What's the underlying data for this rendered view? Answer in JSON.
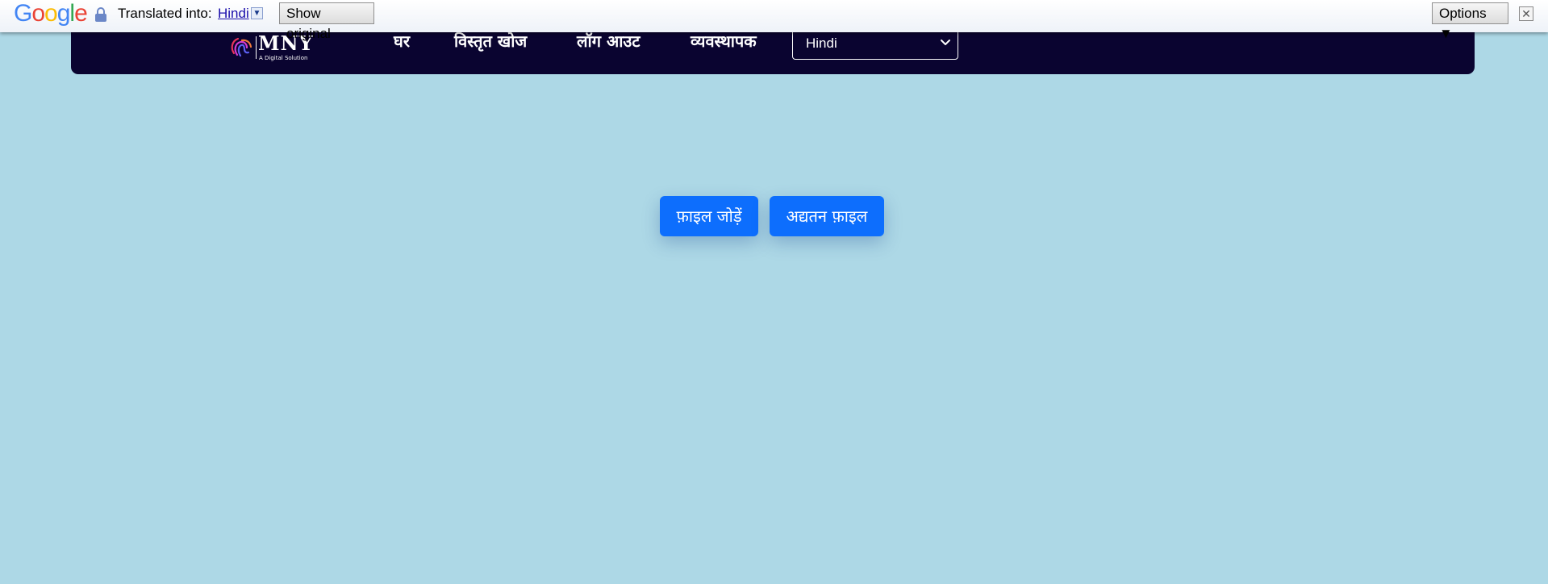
{
  "translate_bar": {
    "logo_letters": [
      "G",
      "o",
      "o",
      "g",
      "l",
      "e"
    ],
    "label": "Translated into:",
    "language": "Hindi",
    "language_arrow": "▼",
    "show_original": "Show original",
    "options": "Options ▼",
    "close": "✕",
    "icons": [
      "lock-icon",
      "close-icon"
    ]
  },
  "navbar": {
    "brand": {
      "name": "MNY",
      "tagline": "A Digital Solution"
    },
    "links": {
      "home": "घर",
      "advanced_search": "विस्तृत खोज",
      "logout": "लॉग आउट",
      "admin": "व्यवस्थापक"
    },
    "language_select": {
      "selected": "Hindi"
    }
  },
  "actions": {
    "add_file": "फ़ाइल जोड़ें",
    "update_file": "अद्यतन फ़ाइल"
  },
  "colors": {
    "page_background": "#add8e6",
    "navbar_background": "#0a0430",
    "button_primary": "#0d6efd"
  }
}
